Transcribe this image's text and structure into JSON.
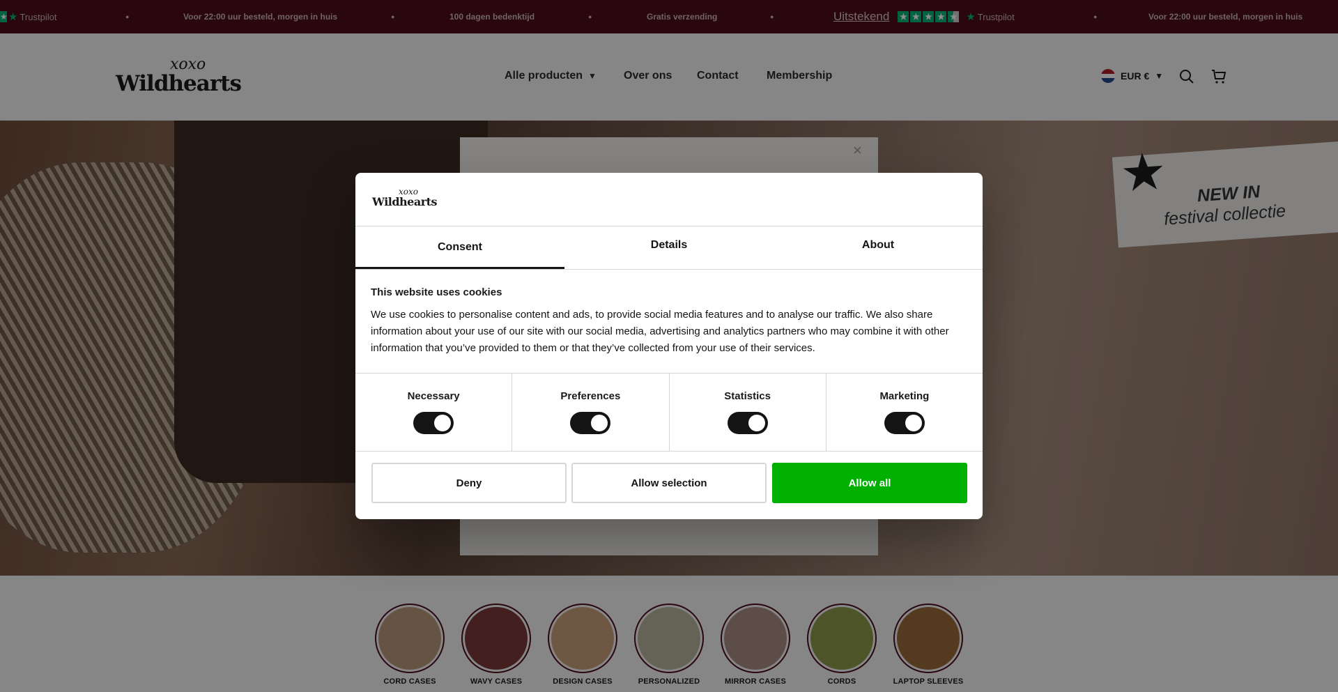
{
  "announcement": {
    "trustpilot_label": "Trustpilot",
    "items": [
      "Voor 22:00 uur besteld, morgen in huis",
      "100 dagen bedenktijd",
      "Gratis verzending"
    ],
    "rating_text": "Uitstekend",
    "brand_color": "#4d0b1d",
    "trustpilot_green": "#00b67a"
  },
  "header": {
    "logo_top": "xoxo",
    "logo_name": "Wildhearts",
    "nav": [
      "Alle producten",
      "Over ons",
      "Contact",
      "Membership"
    ],
    "currency": "EUR €",
    "icons": [
      "search-icon",
      "cart-icon"
    ]
  },
  "hero": {
    "tag_line1": "NEW IN",
    "tag_line2": "festival collectie",
    "popup_close": "×"
  },
  "categories": [
    {
      "label": "CORD CASES",
      "color": "#b89a7a"
    },
    {
      "label": "WAVY CASES",
      "color": "#7a3a3a"
    },
    {
      "label": "DESIGN CASES",
      "color": "#c9a17a"
    },
    {
      "label": "PERSONALIZED",
      "color": "#b7b59c"
    },
    {
      "label": "MIRROR CASES",
      "color": "#a88c86"
    },
    {
      "label": "CORDS",
      "color": "#8a9a4a"
    },
    {
      "label": "LAPTOP SLEEVES",
      "color": "#9a6a3a"
    }
  ],
  "consent": {
    "logo_top": "xoxo",
    "logo_name": "Wildhearts",
    "tabs": [
      "Consent",
      "Details",
      "About"
    ],
    "active_tab": "Consent",
    "title": "This website uses cookies",
    "body": "We use cookies to personalise content and ads, to provide social media features and to analyse our traffic. We also share information about your use of our site with our social media, advertising and analytics partners who may combine it with other information that you’ve provided to them or that they’ve collected from your use of their services.",
    "toggles": [
      {
        "label": "Necessary",
        "checked": true
      },
      {
        "label": "Preferences",
        "checked": true
      },
      {
        "label": "Statistics",
        "checked": true
      },
      {
        "label": "Marketing",
        "checked": true
      }
    ],
    "buttons": {
      "deny": "Deny",
      "allow_selection": "Allow selection",
      "allow_all": "Allow all"
    },
    "accent": "#00b000"
  }
}
